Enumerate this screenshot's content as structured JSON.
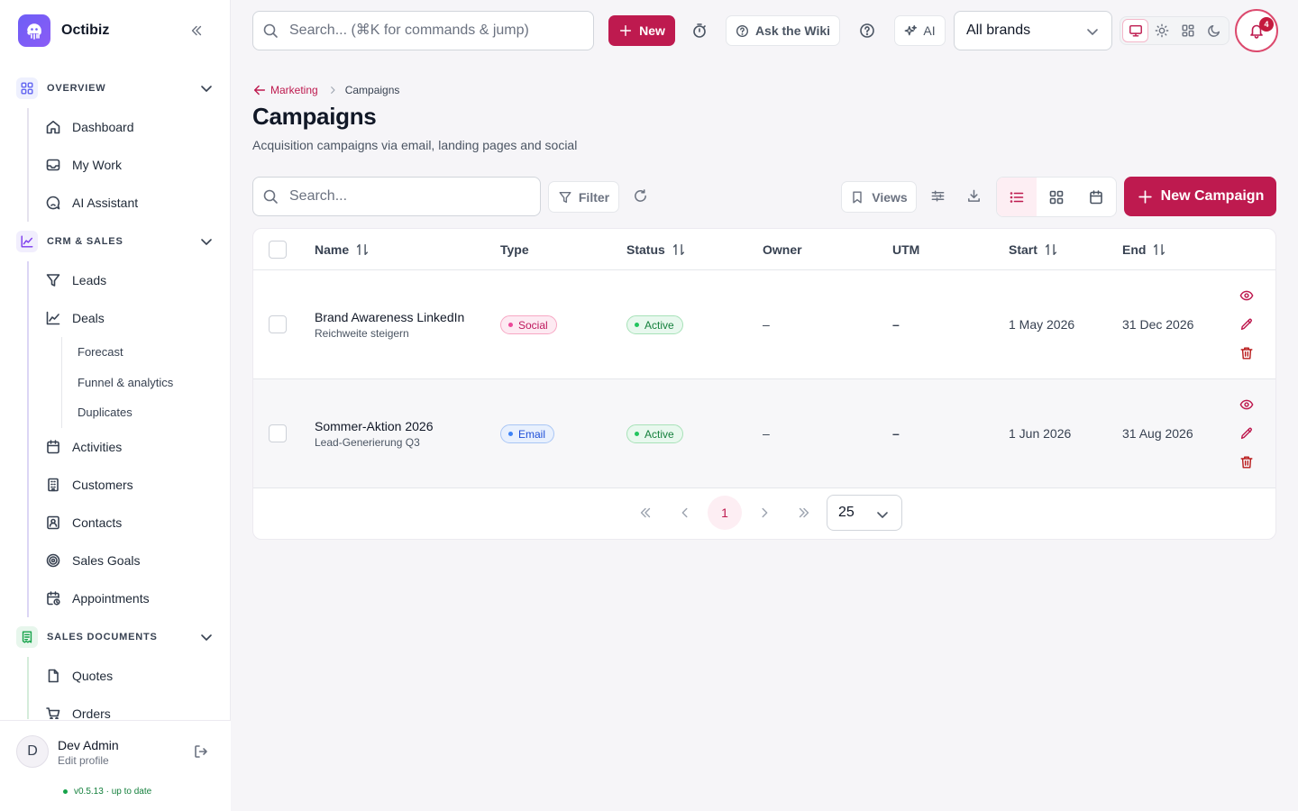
{
  "app": {
    "name": "Octibiz"
  },
  "topbar": {
    "search_placeholder": "Search... (⌘K for commands & jump)",
    "new_label": "New",
    "wiki_label": "Ask the Wiki",
    "ai_label": "AI",
    "brand_selected": "All brands",
    "notification_count": "4"
  },
  "sidebar": {
    "sections": [
      {
        "label": "OVERVIEW",
        "items": [
          "Dashboard",
          "My Work",
          "AI Assistant"
        ]
      },
      {
        "label": "CRM & SALES",
        "items": [
          "Leads",
          "Deals",
          "Activities",
          "Customers",
          "Contacts",
          "Sales Goals",
          "Appointments"
        ],
        "deals_subitems": [
          "Forecast",
          "Funnel & analytics",
          "Duplicates"
        ]
      },
      {
        "label": "SALES DOCUMENTS",
        "items": [
          "Quotes",
          "Orders"
        ]
      }
    ],
    "user": {
      "initial": "D",
      "name": "Dev Admin",
      "edit_label": "Edit profile"
    },
    "version": "v0.5.13 · up to date"
  },
  "page": {
    "breadcrumb_parent": "Marketing",
    "breadcrumb_current": "Campaigns",
    "title": "Campaigns",
    "subtitle": "Acquisition campaigns via email, landing pages and social"
  },
  "toolbar": {
    "search_placeholder": "Search...",
    "filter_label": "Filter",
    "views_label": "Views",
    "new_campaign_label": "New Campaign"
  },
  "table": {
    "columns": [
      "Name",
      "Type",
      "Status",
      "Owner",
      "UTM",
      "Start",
      "End"
    ],
    "rows": [
      {
        "name": "Brand Awareness LinkedIn",
        "subtitle": "Reichweite steigern",
        "type": "Social",
        "status": "Active",
        "owner": "–",
        "utm": "–",
        "start": "1 May 2026",
        "end": "31 Dec 2026"
      },
      {
        "name": "Sommer-Aktion 2026",
        "subtitle": "Lead-Generierung Q3",
        "type": "Email",
        "status": "Active",
        "owner": "–",
        "utm": "–",
        "start": "1 Jun 2026",
        "end": "31 Aug 2026"
      }
    ]
  },
  "pagination": {
    "current_page": "1",
    "per_page": "25"
  },
  "colors": {
    "accent": "#be1a4f",
    "social": "#ec4899",
    "email": "#3b82f6",
    "active": "#22c55e"
  }
}
